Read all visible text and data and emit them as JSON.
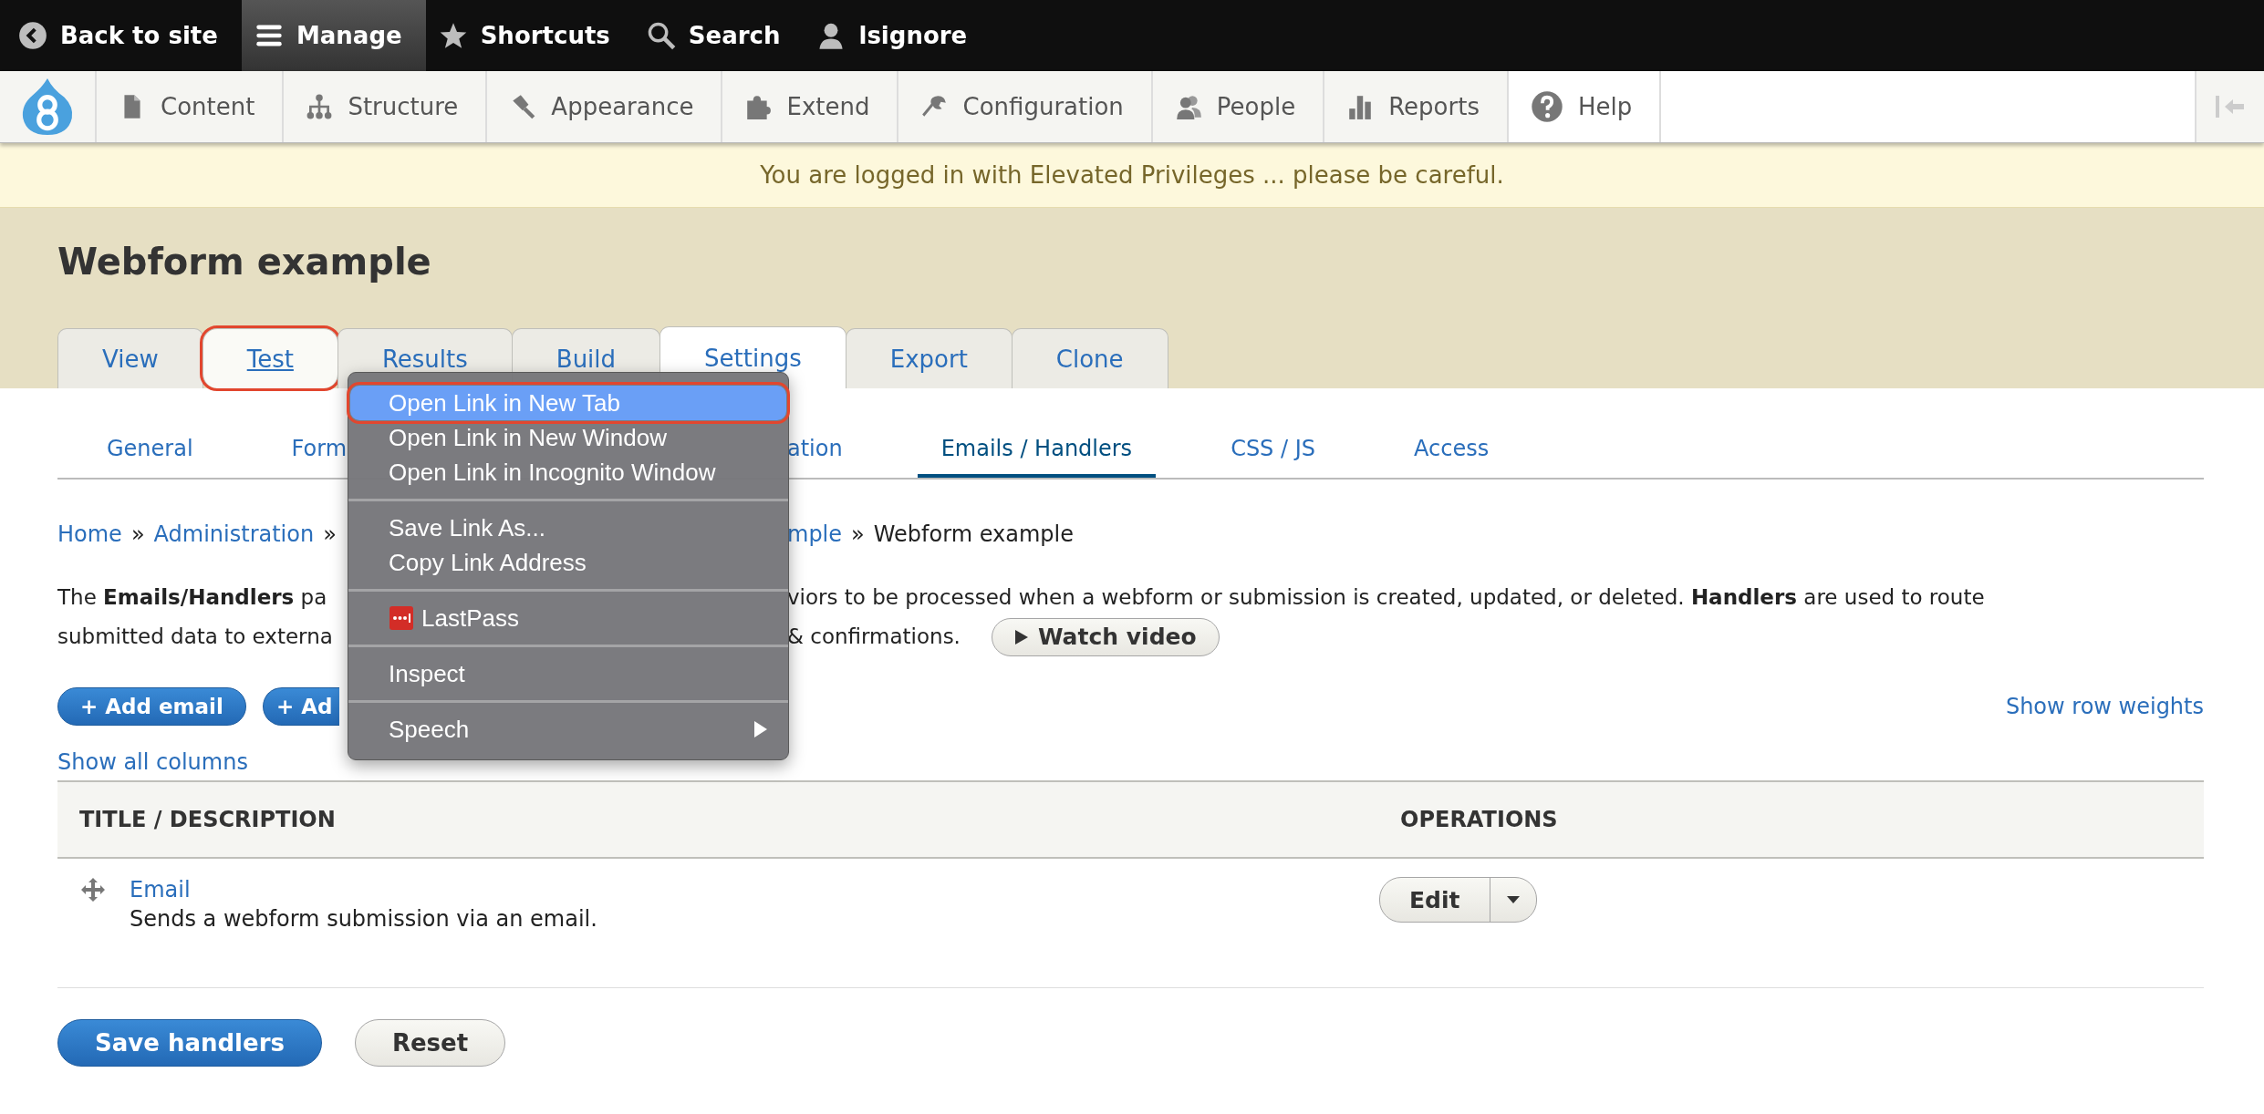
{
  "admin_toolbar": {
    "items": [
      {
        "label": "Back to site",
        "selected": false
      },
      {
        "label": "Manage",
        "selected": true
      },
      {
        "label": "Shortcuts",
        "selected": false
      },
      {
        "label": "Search",
        "selected": false
      },
      {
        "label": "lsignore",
        "selected": false
      }
    ]
  },
  "tray": {
    "items": [
      {
        "label": "Content"
      },
      {
        "label": "Structure"
      },
      {
        "label": "Appearance"
      },
      {
        "label": "Extend"
      },
      {
        "label": "Configuration"
      },
      {
        "label": "People"
      },
      {
        "label": "Reports"
      }
    ],
    "secondary": [
      {
        "label": "Help"
      }
    ]
  },
  "warning": "You are logged in with Elevated Privileges ... please be careful.",
  "page_title": "Webform example",
  "tabs": [
    {
      "label": "View",
      "selected": false,
      "highlighted": false
    },
    {
      "label": "Test",
      "selected": false,
      "highlighted": true
    },
    {
      "label": "Results",
      "selected": false,
      "highlighted": false
    },
    {
      "label": "Build",
      "selected": false,
      "highlighted": false
    },
    {
      "label": "Settings",
      "selected": true,
      "highlighted": false
    },
    {
      "label": "Export",
      "selected": false,
      "highlighted": false
    },
    {
      "label": "Clone",
      "selected": false,
      "highlighted": false
    }
  ],
  "sub_tabs": {
    "before_menu": [
      {
        "label": "General",
        "selected": false
      },
      {
        "label": "Form",
        "selected": false
      }
    ],
    "after_menu": [
      {
        "label": "ation",
        "selected": false
      },
      {
        "label": "Emails / Handlers",
        "selected": true
      },
      {
        "label": "CSS / JS",
        "selected": false
      },
      {
        "label": "Access",
        "selected": false
      }
    ]
  },
  "breadcrumb": {
    "separator": "»",
    "before_menu": [
      "Home",
      "Administration"
    ],
    "after_menu": [
      "mple"
    ],
    "current": "Webform example"
  },
  "description": {
    "lines": [
      {
        "left": "The **Emails/Handlers** pa",
        "right": "viors to be processed when a webform or submission is created, updated, or deleted. **Handlers** are used to route"
      },
      {
        "left": "submitted data to externa",
        "right": "& confirmations."
      }
    ],
    "video_button": "Watch video"
  },
  "actions": [
    {
      "label": "+ Add email"
    },
    {
      "label": "+ Ad"
    }
  ],
  "show_row_weights": "Show row weights",
  "show_all_columns": "Show all columns",
  "table": {
    "columns": [
      "TITLE / DESCRIPTION",
      "OPERATIONS"
    ],
    "rows": [
      {
        "title": "Email",
        "description": "Sends a webform submission via an email.",
        "operation": "Edit"
      }
    ]
  },
  "form_buttons": [
    {
      "label": "Save handlers",
      "kind": "primary"
    },
    {
      "label": "Reset",
      "kind": "secondary"
    }
  ],
  "context_menu": {
    "groups": [
      {
        "items": [
          {
            "label": "Open Link in New Tab",
            "kind": "text",
            "selected": true,
            "highlighted": true
          },
          {
            "label": "Open Link in New Window",
            "kind": "text",
            "selected": false,
            "highlighted": false
          },
          {
            "label": "Open Link in Incognito Window",
            "kind": "text",
            "selected": false,
            "highlighted": false
          }
        ]
      },
      {
        "items": [
          {
            "label": "Save Link As...",
            "kind": "text",
            "selected": false,
            "highlighted": false
          },
          {
            "label": "Copy Link Address",
            "kind": "text",
            "selected": false,
            "highlighted": false
          }
        ]
      },
      {
        "items": [
          {
            "label": "LastPass",
            "kind": "app",
            "selected": false,
            "highlighted": false
          }
        ]
      },
      {
        "items": [
          {
            "label": "Inspect",
            "kind": "text",
            "selected": false,
            "highlighted": false
          }
        ]
      },
      {
        "items": [
          {
            "label": "Speech",
            "kind": "submenu",
            "selected": false,
            "highlighted": false
          }
        ]
      }
    ]
  }
}
